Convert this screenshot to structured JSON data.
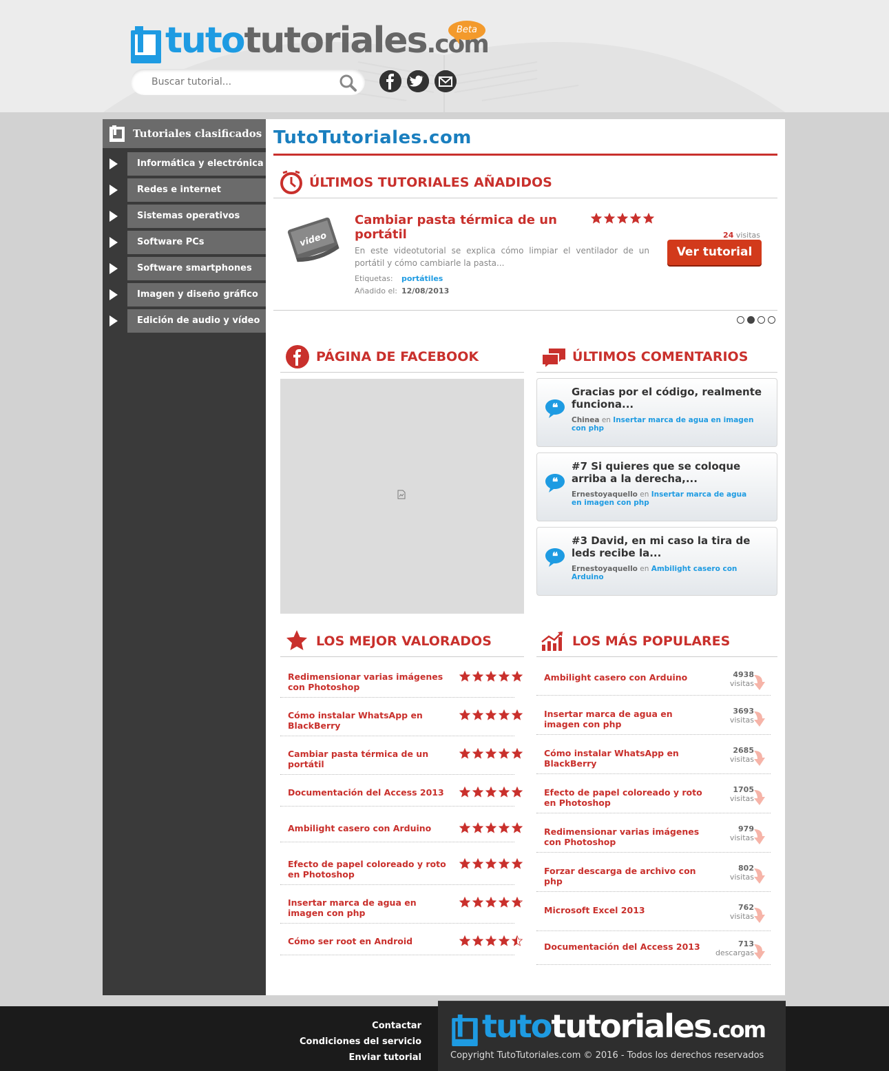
{
  "brand": {
    "logo_part1": "tuto",
    "logo_part2": "tutoriales",
    "logo_part3": ".com",
    "badge": "Beta",
    "primary_color": "#1e9be2",
    "accent_color": "#c9302c"
  },
  "search": {
    "placeholder": "Buscar tutorial...",
    "icon": "search-icon"
  },
  "social": [
    {
      "name": "facebook",
      "icon": "facebook-icon"
    },
    {
      "name": "twitter",
      "icon": "twitter-icon"
    },
    {
      "name": "email",
      "icon": "mail-icon"
    }
  ],
  "sidebar": {
    "title": "Tutoriales clasificados",
    "items": [
      {
        "label": "Informática y electrónica"
      },
      {
        "label": "Redes e internet"
      },
      {
        "label": "Sistemas operativos"
      },
      {
        "label": "Software PCs"
      },
      {
        "label": "Software smartphones"
      },
      {
        "label": "Imagen y diseño gráfico"
      },
      {
        "label": "Edición de audio y vídeo"
      }
    ]
  },
  "main": {
    "site_title": "TutoTutoriales.com",
    "latest": {
      "heading": "ÚLTIMOS TUTORIALES AÑADIDOS",
      "title": "Cambiar pasta térmica de un portátil",
      "icon_text": "video",
      "rating": 5,
      "description": "En este videotutorial se explica cómo limpiar el ventilador de un portátil y cómo cambiarle la pasta...",
      "tags_label": "Etiquetas:",
      "tags_value": "portátiles",
      "added_label": "Añadido el:",
      "added_value": "12/08/2013",
      "visits_count": "24",
      "visits_label": "visitas",
      "button_label": "Ver tutorial",
      "carousel_active": 2,
      "carousel_total": 4
    },
    "facebook": {
      "heading": "PÁGINA DE FACEBOOK"
    },
    "comments": {
      "heading": "ÚLTIMOS COMENTARIOS",
      "items": [
        {
          "text": "Gracias por el código, realmente funciona...",
          "author": "Chinea",
          "connector": "en",
          "tutorial": "Insertar marca de agua en imagen con php"
        },
        {
          "text": "#7 Si quieres que se coloque arriba a la derecha,...",
          "author": "Ernestoyaquello",
          "connector": "en",
          "tutorial": "Insertar marca de agua en imagen con php"
        },
        {
          "text": "#3 David, en mi caso la tira de leds recibe la...",
          "author": "Ernestoyaquello",
          "connector": "en",
          "tutorial": "Ambilight casero con Arduino"
        }
      ]
    },
    "top_rated": {
      "heading": "LOS MEJOR VALORADOS",
      "items": [
        {
          "title": "Redimensionar varias imágenes con Photoshop",
          "rating": 5
        },
        {
          "title": "Cómo instalar WhatsApp en BlackBerry",
          "rating": 5
        },
        {
          "title": "Cambiar pasta térmica de un portátil",
          "rating": 5
        },
        {
          "title": "Documentación del Access 2013",
          "rating": 5
        },
        {
          "title": "Ambilight casero con Arduino",
          "rating": 5
        },
        {
          "title": "Efecto de papel coloreado y roto en Photoshop",
          "rating": 4.9
        },
        {
          "title": "Insertar marca de agua en imagen con php",
          "rating": 4.8
        },
        {
          "title": "Cómo ser root en Android",
          "rating": 4.5
        }
      ]
    },
    "popular": {
      "heading": "LOS MÁS POPULARES",
      "items": [
        {
          "title": "Ambilight casero con Arduino",
          "count": "4938",
          "label": "visitas"
        },
        {
          "title": "Insertar marca de agua en imagen con php",
          "count": "3693",
          "label": "visitas"
        },
        {
          "title": "Cómo instalar WhatsApp en BlackBerry",
          "count": "2685",
          "label": "visitas"
        },
        {
          "title": "Efecto de papel coloreado y roto en Photoshop",
          "count": "1705",
          "label": "visitas"
        },
        {
          "title": "Redimensionar varias imágenes con Photoshop",
          "count": "979",
          "label": "visitas"
        },
        {
          "title": "Forzar descarga de archivo con php",
          "count": "802",
          "label": "visitas"
        },
        {
          "title": "Microsoft Excel 2013",
          "count": "762",
          "label": "visitas"
        },
        {
          "title": "Documentación del Access 2013",
          "count": "713",
          "label": "descargas"
        }
      ]
    }
  },
  "footer": {
    "links": [
      {
        "label": "Contactar"
      },
      {
        "label": "Condiciones del servicio"
      },
      {
        "label": "Enviar tutorial"
      }
    ],
    "copyright": "Copyright TutoTutoriales.com © 2016 - Todos los derechos reservados"
  }
}
